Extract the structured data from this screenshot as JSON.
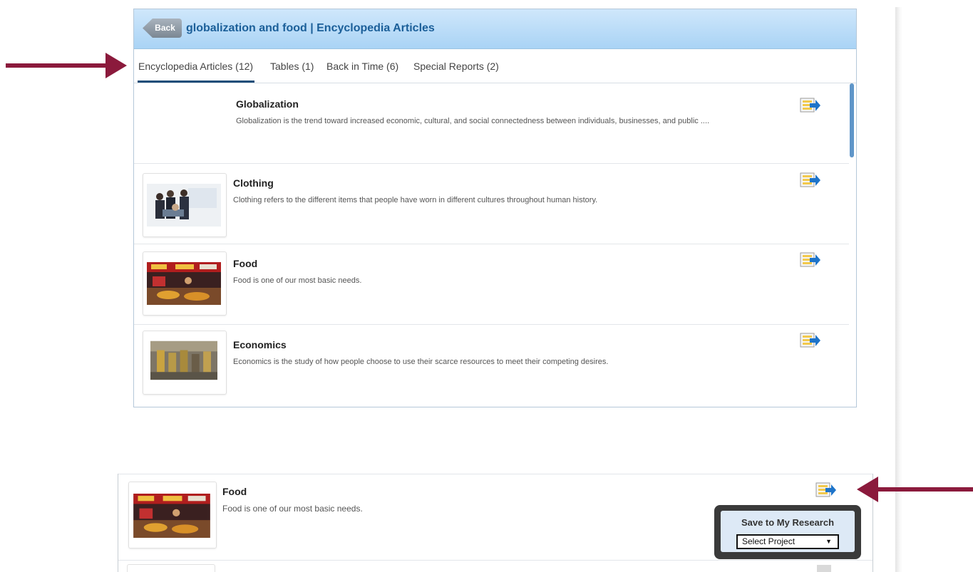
{
  "header": {
    "back_label": "Back",
    "title": "globalization and food | Encyclopedia Articles"
  },
  "tabs": [
    {
      "label": "Encyclopedia Articles (12)",
      "active": true
    },
    {
      "label": "Tables (1)",
      "active": false
    },
    {
      "label": "Back in Time (6)",
      "active": false
    },
    {
      "label": "Special Reports (2)",
      "active": false
    }
  ],
  "articles": [
    {
      "title": "Globalization",
      "description": "Globalization is the trend toward increased economic, cultural, and social connectedness between individuals, businesses, and public ....",
      "thumbnail": false
    },
    {
      "title": "Clothing",
      "description": "Clothing refers to the different items that people have worn in different cultures throughout human history.",
      "thumbnail": true
    },
    {
      "title": "Food",
      "description": "Food  is one of our most basic needs.",
      "thumbnail": true
    },
    {
      "title": "Economics",
      "description": "Economics is the study of how people choose to use their scarce resources to meet their competing desires.",
      "thumbnail": true
    }
  ],
  "zoom": {
    "title": "Food",
    "description": "Food  is one of our most basic needs.",
    "popup_title": "Save to My Research",
    "select_value": "Select Project",
    "caret": "▼"
  },
  "colors": {
    "arrow": "#8b1a3c",
    "header_title": "#1b5f99",
    "tab_underline": "#1f4e79"
  },
  "icons": [
    "save-to-research-icon",
    "back-arrow-button",
    "annotation-arrow"
  ]
}
